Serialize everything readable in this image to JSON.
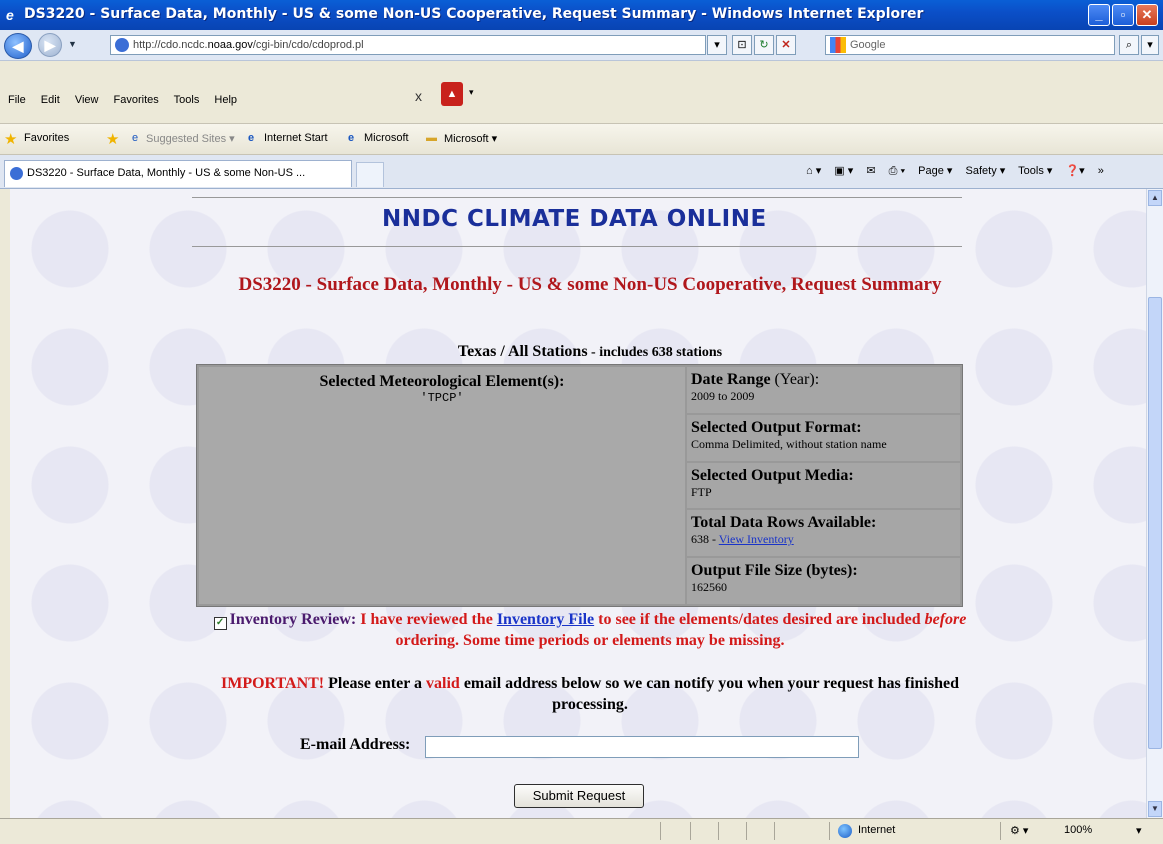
{
  "window": {
    "title": "DS3220 - Surface Data, Monthly - US & some Non-US Cooperative, Request Summary - Windows Internet Explorer"
  },
  "addressbar": {
    "url_prefix": "http://cdo.ncdc.",
    "url_domain": "noaa.gov",
    "url_suffix": "/cgi-bin/cdo/cdoprod.pl",
    "search_placeholder": "Google"
  },
  "menu": {
    "items": [
      "File",
      "Edit",
      "View",
      "Favorites",
      "Tools",
      "Help"
    ]
  },
  "favorites": {
    "label": "Favorites",
    "items": [
      "Suggested Sites ▾",
      "Internet Start",
      "Microsoft",
      "Microsoft ▾"
    ]
  },
  "tabs": {
    "active": "DS3220 - Surface Data, Monthly - US & some Non-US ..."
  },
  "commandbar": {
    "items": [
      "Page ▾",
      "Safety ▾",
      "Tools ▾"
    ]
  },
  "page": {
    "site_title": "NNDC CLIMATE DATA ONLINE",
    "ds_title": "DS3220 - Surface Data, Monthly - US & some Non-US Cooperative, Request Summary",
    "stations_main": "Texas / All Stations",
    "stations_suffix": " - includes 638 stations",
    "elements_header": "Selected Meteorological Element(s):",
    "elements_value": "'TPCP'",
    "date_range_label": "Date Range",
    "date_range_unit": " (Year):",
    "date_range_value": "2009 to 2009",
    "output_format_label": "Selected Output Format:",
    "output_format_value": "Comma Delimited, without station name",
    "output_media_label": "Selected Output Media:",
    "output_media_value": "FTP",
    "rows_label": "Total Data Rows Available:",
    "rows_value": "638 - ",
    "rows_link": "View Inventory",
    "size_label": "Output File Size (bytes):",
    "size_value": "162560",
    "inv_review_label": "Inventory Review:",
    "inv_text1": " I have reviewed the ",
    "inv_link": "Inventory File",
    "inv_text2": " to see if the elements/dates desired are included ",
    "inv_before": "before",
    "inv_text3": " ordering. Some time periods or elements may be missing.",
    "important": "IMPORTANT!",
    "important_text1": " Please enter a ",
    "important_valid": "valid",
    "important_text2": " email address below so we can notify you when your request has finished processing.",
    "email_label": "E-mail Address:",
    "email_value": "",
    "submit_label": "Submit Request"
  },
  "statusbar": {
    "zone": "Internet",
    "zoom": "100%"
  }
}
